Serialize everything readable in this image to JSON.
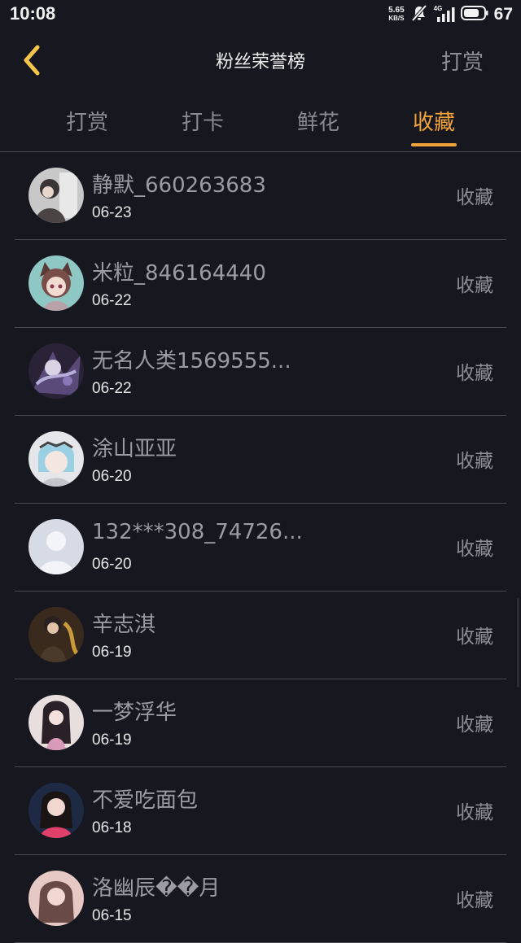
{
  "status_bar": {
    "time": "10:08",
    "net_speed_value": "5.65",
    "net_speed_unit": "KB/S",
    "network_type": "4G",
    "battery_level": "67"
  },
  "header": {
    "title": "粉丝荣誉榜",
    "action_label": "打赏"
  },
  "tabs": [
    {
      "label": "打赏",
      "active": false
    },
    {
      "label": "打卡",
      "active": false
    },
    {
      "label": "鲜花",
      "active": false
    },
    {
      "label": "收藏",
      "active": true
    }
  ],
  "colors": {
    "accent": "#f2a33a",
    "background": "#17171f",
    "divider": "#4a4a52"
  },
  "list": {
    "items": [
      {
        "name": "静默_660263683",
        "date": "06-23",
        "action": "收藏"
      },
      {
        "name": "米粒_846164440",
        "date": "06-22",
        "action": "收藏"
      },
      {
        "name": "无名人类1569555...",
        "date": "06-22",
        "action": "收藏"
      },
      {
        "name": "涂山亚亚",
        "date": "06-20",
        "action": "收藏"
      },
      {
        "name": "132***308_74726...",
        "date": "06-20",
        "action": "收藏"
      },
      {
        "name": "辛志淇",
        "date": "06-19",
        "action": "收藏"
      },
      {
        "name": "一梦浮华",
        "date": "06-19",
        "action": "收藏"
      },
      {
        "name": "不爱吃面包",
        "date": "06-18",
        "action": "收藏"
      },
      {
        "name": "洛幽辰��月",
        "date": "06-15",
        "action": "收藏"
      }
    ]
  }
}
